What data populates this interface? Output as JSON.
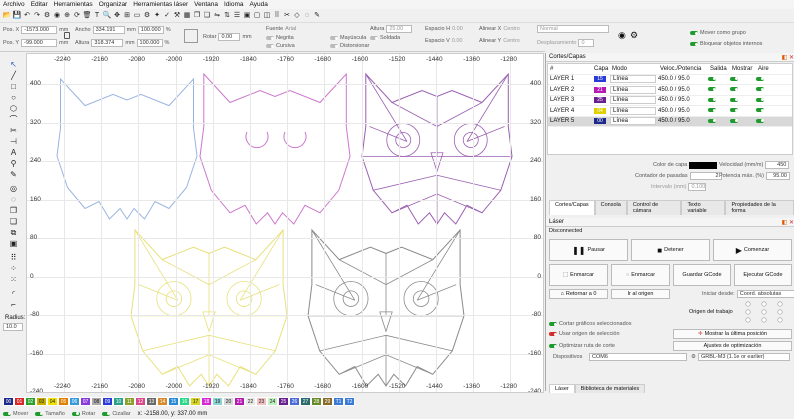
{
  "menu": [
    "Archivo",
    "Editar",
    "Herramientas",
    "Organizar",
    "Herramientas láser",
    "Ventana",
    "Idioma",
    "Ayuda"
  ],
  "toolbar_icons": [
    "open-icon",
    "save-icon",
    "undo-icon",
    "redo-icon",
    "settings-icon",
    "camera-icon",
    "zoom-icon",
    "rotate-icon",
    "delete-icon",
    "text-icon",
    "magnify-icon",
    "pan-icon",
    "zoom-fit-icon",
    "frame-icon",
    "gear-icon",
    "wand-icon",
    "check-icon",
    "tools-icon",
    "grid-icon",
    "copy-icon",
    "paste-icon",
    "flip-icon",
    "mirror-icon",
    "align-icon",
    "group-icon",
    "ungroup-icon",
    "weld-icon",
    "array-icon",
    "cut-icon",
    "node-icon",
    "offset-icon",
    "trace-icon"
  ],
  "props": {
    "pos_x_label": "Pos. X",
    "pos_x": "-1573.000",
    "pos_y_label": "Pos. Y",
    "pos_y": "-99.000",
    "unit_mm": "mm",
    "width_label": "Ancho",
    "width": "334.191",
    "height_label": "Altura",
    "height": "318.374",
    "scale_w": "100.000",
    "scale_h": "100.000",
    "pct": "%",
    "rotate_label": "Rotar",
    "rotate": "0.00",
    "font_label": "Fuente",
    "font": "Arial",
    "height2_label": "Altura",
    "height2": "25.00",
    "hspace_label": "Espacio H",
    "hspace": "0.00",
    "vspace_label": "Espacio V",
    "vspace": "0.00",
    "align_x_label": "Alinear X",
    "align_x": "Centro",
    "align_y_label": "Alinear Y",
    "align_y": "Centro",
    "mode": "Normal",
    "offset_label": "Desplazamiento",
    "offset": "0",
    "bold": "Negrita",
    "italic": "Cursiva",
    "upper": "Mayúscula",
    "distort": "Distorsionar",
    "weld": "Soldada",
    "move_group": "Mover como grupo",
    "lock_objects": "Bloquear objetos internos"
  },
  "axes": {
    "x_ticks": [
      "-2240",
      "-2160",
      "-2080",
      "-2000",
      "-1920",
      "-1840",
      "-1760",
      "-1680",
      "-1600",
      "-1520",
      "-1440",
      "-1360",
      "-1280"
    ],
    "y_ticks": [
      "400",
      "320",
      "240",
      "160",
      "80",
      "0",
      "-80",
      "-160",
      "-240"
    ]
  },
  "cuts_panel": {
    "title": "Cortes/Capas",
    "headers": [
      "#",
      "Capa",
      "Modo",
      "Veloc./Potencia",
      "Salida",
      "Mostrar",
      "Aire"
    ],
    "rows": [
      {
        "name": "LAYER 1",
        "num": "15",
        "color": "#2a3bd6",
        "mode": "Línea",
        "speed": "450.0 / 95.0"
      },
      {
        "name": "LAYER 2",
        "num": "21",
        "color": "#b31bb3",
        "mode": "Línea",
        "speed": "450.0 / 95.0"
      },
      {
        "name": "LAYER 3",
        "num": "25",
        "color": "#6a1f8f",
        "mode": "Línea",
        "speed": "450.0 / 95.0"
      },
      {
        "name": "LAYER 4",
        "num": "04",
        "color": "#e0d000",
        "mode": "Línea",
        "speed": "450.0 / 95.0"
      },
      {
        "name": "LAYER 5",
        "num": "00",
        "color": "#1e2a8a",
        "mode": "Línea",
        "speed": "450.0 / 95.0"
      }
    ],
    "layer_color_label": "Color de capa",
    "speed_label": "Velocidad (mm/m)",
    "speed_value": "450",
    "passes_label": "Contador de pasadas",
    "passes_value": "2",
    "power_label": "Potencia máx. (%)",
    "power_value": "95.00",
    "interval_label": "Intervalo (mm)",
    "interval_value": "0.100",
    "tabs": [
      "Cortes/Capas",
      "Consola",
      "Control de cámara",
      "Texto variable",
      "Propiedades de la forma"
    ]
  },
  "laser_panel": {
    "title": "Láser",
    "status": "Disconnected",
    "pause": "Pausar",
    "stop": "Detener",
    "start": "Comenzar",
    "frame": "Enmarcar",
    "frame2": "Enmarcar",
    "save_gcode": "Guardar GCode",
    "run_gcode": "Ejecutar GCode",
    "home": "Retornar a 0",
    "go_origin": "Ir al origen",
    "start_from_label": "Iniciar desde:",
    "start_from": "Coord. absolutas",
    "job_origin": "Origen del trabajo",
    "cut_selected": "Cortar gráficos seleccionados",
    "use_origin": "Usar origen de selección",
    "optimize": "Optimizar ruta de corte",
    "show_last": "Mostrar la última posición",
    "optimize_settings": "Ajustes de optimización",
    "devices_label": "Dispositivos",
    "port": "COM6",
    "device": "GRBL-M3 (1.1e or earlier)",
    "tabs": [
      "Láser",
      "Biblioteca de materiales"
    ]
  },
  "palette": [
    {
      "n": "00",
      "c": "#1e2a8a"
    },
    {
      "n": "01",
      "c": "#d62a2a"
    },
    {
      "n": "02",
      "c": "#2aa02a"
    },
    {
      "n": "03",
      "c": "#c9b000"
    },
    {
      "n": "04",
      "c": "#f0e000"
    },
    {
      "n": "05",
      "c": "#e08000"
    },
    {
      "n": "06",
      "c": "#3a9ad9"
    },
    {
      "n": "07",
      "c": "#8a3ad9"
    },
    {
      "n": "08",
      "c": "#aaaaaa"
    },
    {
      "n": "09",
      "c": "#2a3bd6"
    },
    {
      "n": "10",
      "c": "#2aa08a"
    },
    {
      "n": "11",
      "c": "#8aa02a"
    },
    {
      "n": "12",
      "c": "#d64a8a"
    },
    {
      "n": "13",
      "c": "#6a6a6a"
    },
    {
      "n": "14",
      "c": "#d68a2a"
    },
    {
      "n": "15",
      "c": "#2a8ad6"
    },
    {
      "n": "16",
      "c": "#2ad68a"
    },
    {
      "n": "17",
      "c": "#d6d62a"
    },
    {
      "n": "18",
      "c": "#d62ad6"
    },
    {
      "n": "19",
      "c": "#8ad6d6"
    },
    {
      "n": "20",
      "c": "#d6d6d6"
    },
    {
      "n": "21",
      "c": "#b31bb3"
    },
    {
      "n": "22",
      "c": "#e8e8e8"
    },
    {
      "n": "23",
      "c": "#f0c0c0"
    },
    {
      "n": "24",
      "c": "#c0f0c0"
    },
    {
      "n": "25",
      "c": "#6a1f8f"
    },
    {
      "n": "26",
      "c": "#4a6ad6"
    },
    {
      "n": "27",
      "c": "#2a6a6a"
    },
    {
      "n": "28",
      "c": "#6a8a2a"
    },
    {
      "n": "29",
      "c": "#8a6a2a"
    },
    {
      "n": "T1",
      "c": "#3a7ad6"
    },
    {
      "n": "T2",
      "c": "#3a7ad6"
    }
  ],
  "status": {
    "move": "Mover",
    "size": "Tamaño",
    "rotate": "Rotar",
    "shear": "Cizallar",
    "coords": "x: -2158.00, y: 337.00 mm"
  },
  "sidebar": {
    "radius_label": "Radius:",
    "radius": "10.0"
  },
  "colors": {
    "owl_blue": "#9ab4e0",
    "owl_pink": "#cc77cc",
    "owl_purple": "#9a5fb0",
    "owl_yellow": "#e8e07a",
    "owl_gray": "#8a8a8a"
  }
}
